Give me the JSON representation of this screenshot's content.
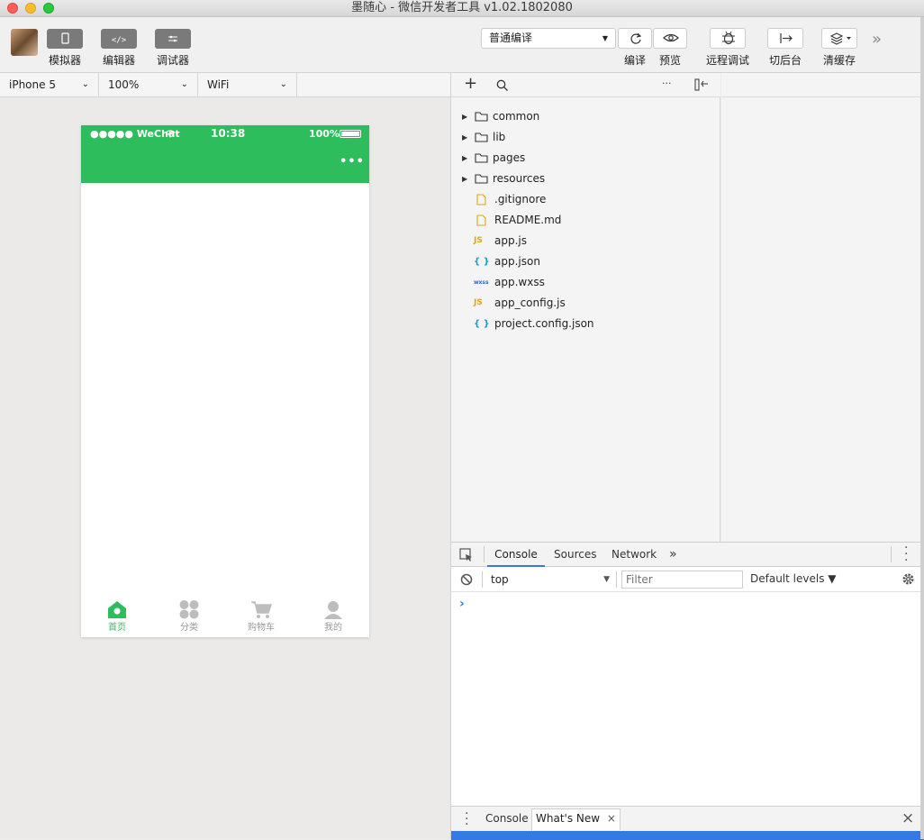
{
  "window": {
    "title": "墨随心 - 微信开发者工具 v1.02.1802080"
  },
  "toolbar": {
    "simulator_label": "模拟器",
    "editor_label": "编辑器",
    "debugger_label": "调试器",
    "compile_mode": "普通编译",
    "compile_label": "编译",
    "preview_label": "预览",
    "remote_debug_label": "远程调试",
    "background_label": "切后台",
    "clear_cache_label": "清缓存",
    "more_symbol": "»"
  },
  "devicebar": {
    "device": "iPhone 5",
    "zoom": "100%",
    "network": "WiFi"
  },
  "phone": {
    "carrier": "●●●●● WeChat",
    "time": "10:38",
    "battery": "100%",
    "menu_dots": "•••",
    "accent": "#2ebd5d",
    "tabs": [
      {
        "label": "首页",
        "icon": "home-icon",
        "active": true
      },
      {
        "label": "分类",
        "icon": "category-icon",
        "active": false
      },
      {
        "label": "购物车",
        "icon": "cart-icon",
        "active": false
      },
      {
        "label": "我的",
        "icon": "user-icon",
        "active": false
      }
    ]
  },
  "filetree": {
    "add_symbol": "+",
    "more_symbol": "···",
    "items": [
      {
        "name": "common",
        "type": "folder"
      },
      {
        "name": "lib",
        "type": "folder"
      },
      {
        "name": "pages",
        "type": "folder"
      },
      {
        "name": "resources",
        "type": "folder"
      },
      {
        "name": ".gitignore",
        "type": "file"
      },
      {
        "name": "README.md",
        "type": "file"
      },
      {
        "name": "app.js",
        "type": "js",
        "badge": "JS"
      },
      {
        "name": "app.json",
        "type": "json",
        "badge": "{ }"
      },
      {
        "name": "app.wxss",
        "type": "wxss",
        "badge": "wxss"
      },
      {
        "name": "app_config.js",
        "type": "js",
        "badge": "JS"
      },
      {
        "name": "project.config.json",
        "type": "json",
        "badge": "{ }"
      }
    ]
  },
  "devtools": {
    "tabs": [
      "Console",
      "Sources",
      "Network"
    ],
    "more_tabs": "»",
    "context": "top",
    "filter_placeholder": "Filter",
    "levels": "Default levels ▼",
    "prompt": "›",
    "drawer_tabs": [
      "Console",
      "What's New"
    ],
    "close_symbol": "×",
    "accent": "#3579e6"
  }
}
